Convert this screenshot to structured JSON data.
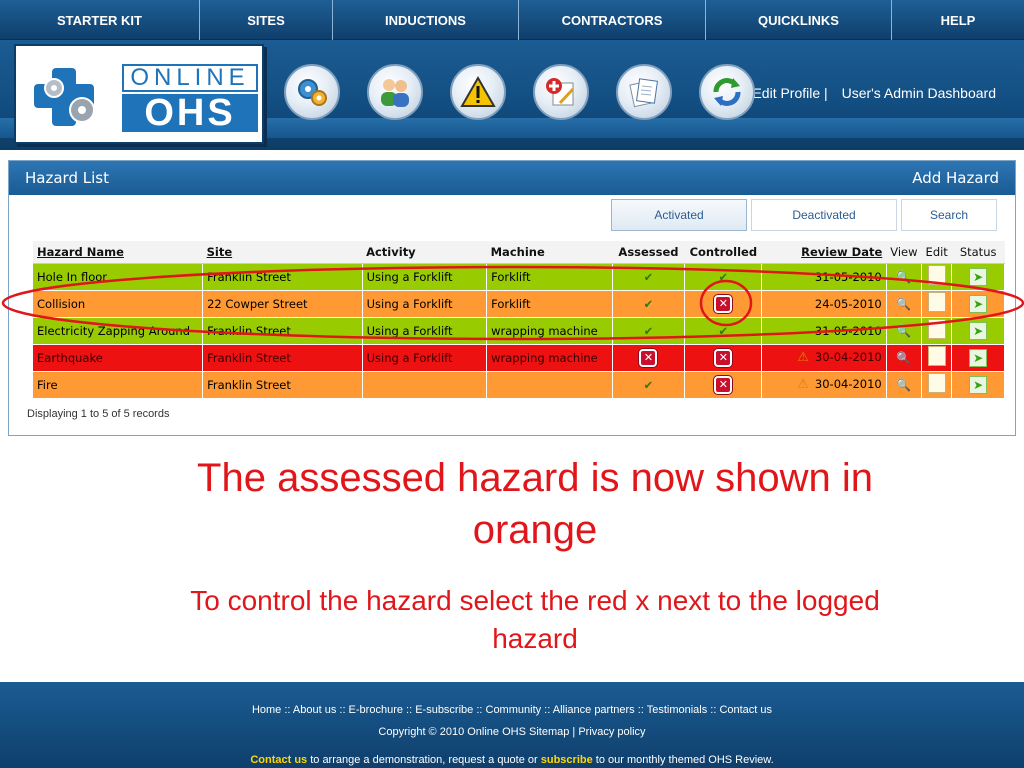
{
  "nav": {
    "items": [
      "STARTER KIT",
      "SITES",
      "INDUCTIONS",
      "CONTRACTORS",
      "QUICKLINKS",
      "HELP"
    ]
  },
  "header": {
    "logo_top": "ONLINE",
    "logo_bottom": "OHS",
    "edit_profile": "Edit Profile |",
    "admin_dashboard": "User's Admin Dashboard",
    "menu_icons": [
      "gears-icon",
      "users-icon",
      "warning-icon",
      "medical-edit-icon",
      "documents-icon",
      "refresh-icon"
    ]
  },
  "panel": {
    "title": "Hazard List",
    "add_hazard": "Add Hazard",
    "tabs": [
      "Activated",
      "Deactivated",
      "Search"
    ],
    "columns": [
      "Hazard Name",
      "Site",
      "Activity",
      "Machine",
      "Assessed",
      "Controlled",
      "Review Date",
      "View",
      "Edit",
      "Status"
    ],
    "rows": [
      {
        "color": "green",
        "name": "Hole In floor",
        "site": "Franklin Street",
        "activity": "Using a Forklift",
        "machine": "Forklift",
        "assessed": "check",
        "controlled": "check",
        "warning": false,
        "review_date": "31-05-2010"
      },
      {
        "color": "orange",
        "name": "Collision",
        "site": "22 Cowper Street",
        "activity": "Using a Forklift",
        "machine": "Forklift",
        "assessed": "check",
        "controlled": "x",
        "warning": false,
        "review_date": "24-05-2010"
      },
      {
        "color": "green",
        "name": "Electricity Zapping Around",
        "site": "Franklin Street",
        "activity": "Using a Forklift",
        "machine": "wrapping machine",
        "assessed": "check",
        "controlled": "check",
        "warning": false,
        "review_date": "31-05-2010"
      },
      {
        "color": "red",
        "name": "Earthquake",
        "site": "Franklin Street",
        "activity": "Using a Forklift",
        "machine": "wrapping machine",
        "assessed": "x",
        "controlled": "x",
        "warning": true,
        "review_date": "30-04-2010"
      },
      {
        "color": "orange",
        "name": "Fire",
        "site": "Franklin Street",
        "activity": "",
        "machine": "",
        "assessed": "check",
        "controlled": "x",
        "warning": true,
        "review_date": "30-04-2010"
      }
    ],
    "records": "Displaying 1 to 5 of 5 records"
  },
  "colors": {
    "green": "#99cc00",
    "orange": "#ff9933",
    "red": "#ee1111",
    "annotation": "#e0161b"
  },
  "captions": {
    "main": "The assessed hazard is now shown in orange",
    "sub": "To control the hazard select the red x next to the logged hazard"
  },
  "footer": {
    "links": "Home :: About us :: E-brochure :: E-subscribe :: Community :: Alliance partners :: Testimonials :: Contact us",
    "copyright": "Copyright © 2010 Online OHS Sitemap | Privacy policy",
    "cta_contact": "Contact us",
    "cta_middle": " to arrange a demonstration, request a quote or ",
    "cta_subscribe": "subscribe",
    "cta_end": " to our monthly themed OHS Review."
  }
}
